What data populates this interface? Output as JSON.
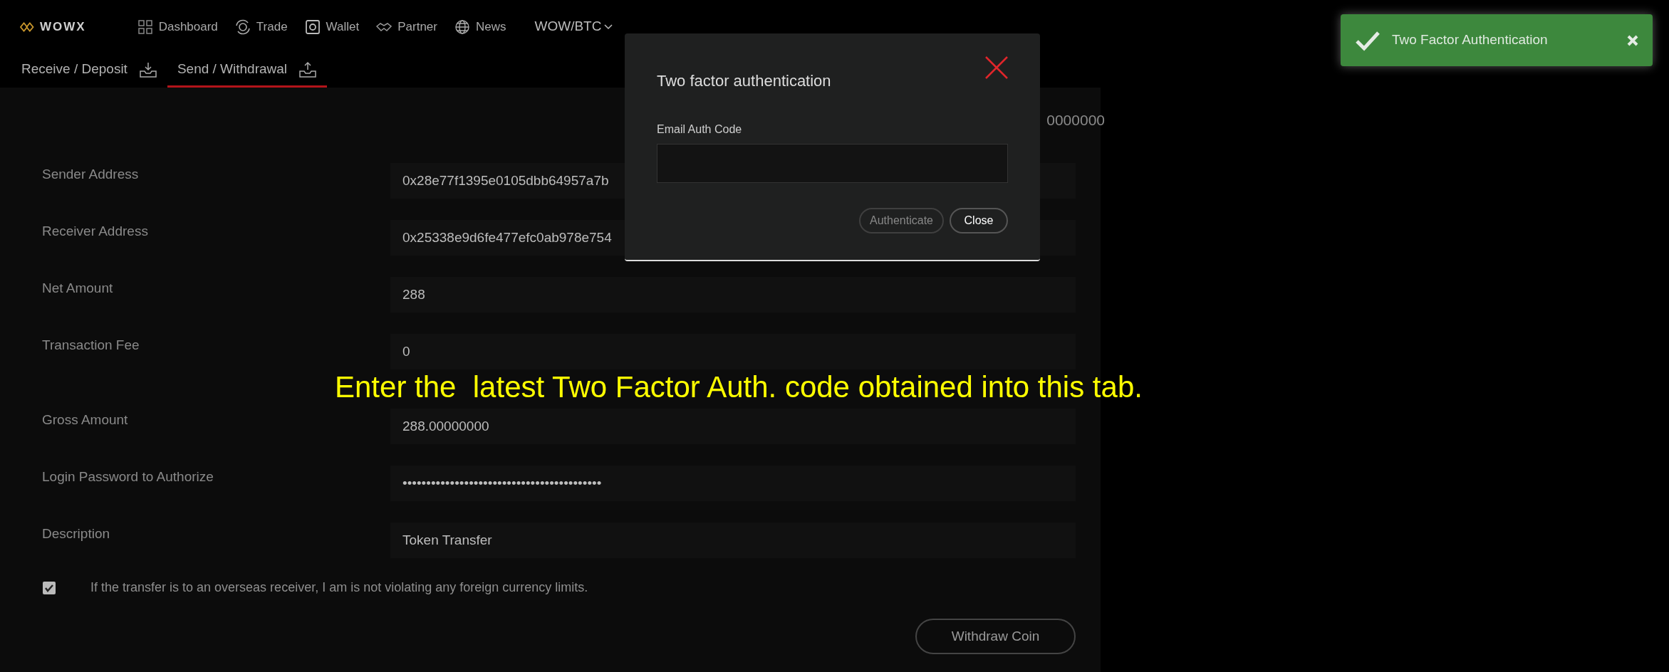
{
  "header": {
    "logo": "WOWX",
    "nav": [
      {
        "label": "Dashboard"
      },
      {
        "label": "Trade"
      },
      {
        "label": "Wallet"
      },
      {
        "label": "Partner"
      },
      {
        "label": "News"
      }
    ],
    "pair": "WOW/BTC"
  },
  "tabs": [
    {
      "label": "Receive / Deposit",
      "selected": false
    },
    {
      "label": "Send / Withdrawal",
      "selected": true
    }
  ],
  "balance_fragment": "0000000",
  "form": {
    "fields": [
      {
        "label": "Sender Address",
        "value": "0x28e77f1395e0105dbb64957a7b"
      },
      {
        "label": "Receiver Address",
        "value": "0x25338e9d6fe477efc0ab978e754"
      },
      {
        "label": "Net Amount",
        "value": "288"
      },
      {
        "label": "Transaction Fee",
        "value": "0"
      },
      {
        "label": "Gross Amount",
        "value": "288.00000000"
      },
      {
        "label": "Login Password to Authorize",
        "value": "••••••••••••••••••••••••••••••••••••••••••"
      },
      {
        "label": "Description",
        "value": "Token Transfer"
      }
    ],
    "agreement": {
      "text": "If the transfer is to an overseas receiver, I am is not violating any foreign currency limits.",
      "checked": true
    },
    "submit": "Withdraw Coin"
  },
  "modal": {
    "title": "Two factor authentication",
    "field_label": "Email Auth Code",
    "buttons": [
      {
        "label": "Authenticate",
        "disabled": true
      },
      {
        "label": "Close",
        "disabled": false
      }
    ]
  },
  "toast": {
    "message": "Two Factor Authentication"
  },
  "caption": "Enter the  latest Two Factor Auth. code obtained into this tab."
}
